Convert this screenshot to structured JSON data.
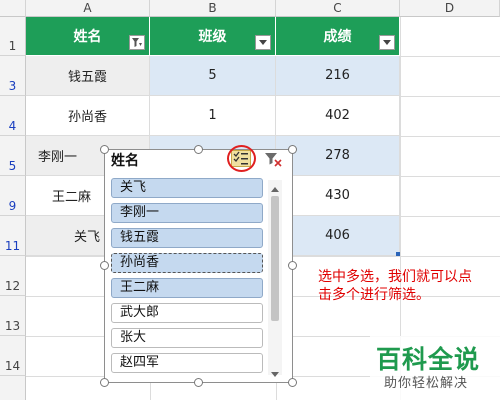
{
  "columns": [
    "A",
    "B",
    "C",
    "D"
  ],
  "row_numbers": [
    "1",
    "3",
    "4",
    "5",
    "9",
    "11",
    "12",
    "13",
    "14"
  ],
  "table_headers": [
    {
      "label": "姓名",
      "filter_state": "filtered"
    },
    {
      "label": "班级",
      "filter_state": "dropdown"
    },
    {
      "label": "成绩",
      "filter_state": "dropdown"
    }
  ],
  "rows": [
    {
      "name": "钱五霞",
      "class": "5",
      "score": "216"
    },
    {
      "name": "孙尚香",
      "class": "1",
      "score": "402"
    },
    {
      "name": "李刚一",
      "class": "",
      "score": "278"
    },
    {
      "name": "王二麻",
      "class": "",
      "score": "430"
    },
    {
      "name": "关飞",
      "class": "",
      "score": "406"
    }
  ],
  "slicer": {
    "title": "姓名",
    "multiselect_icon": "multi-select-icon",
    "clear_icon": "clear-filter-icon",
    "items": [
      {
        "label": "关飞",
        "selected": true
      },
      {
        "label": "李刚一",
        "selected": true
      },
      {
        "label": "钱五霞",
        "selected": true
      },
      {
        "label": "孙尚香",
        "selected": true
      },
      {
        "label": "王二麻",
        "selected": true
      },
      {
        "label": "武大郎",
        "selected": false
      },
      {
        "label": "张大",
        "selected": false
      },
      {
        "label": "赵四军",
        "selected": false
      }
    ]
  },
  "annotation": "选中多选，我们就可以点击多个进行筛选。",
  "watermark": {
    "title": "百科全说",
    "subtitle": "助你轻松解决"
  },
  "colors": {
    "header_green": "#1e9e58",
    "row_blue": "#dce8f5",
    "selected_item": "#c5d9ef",
    "annotation_red": "#e00000"
  }
}
